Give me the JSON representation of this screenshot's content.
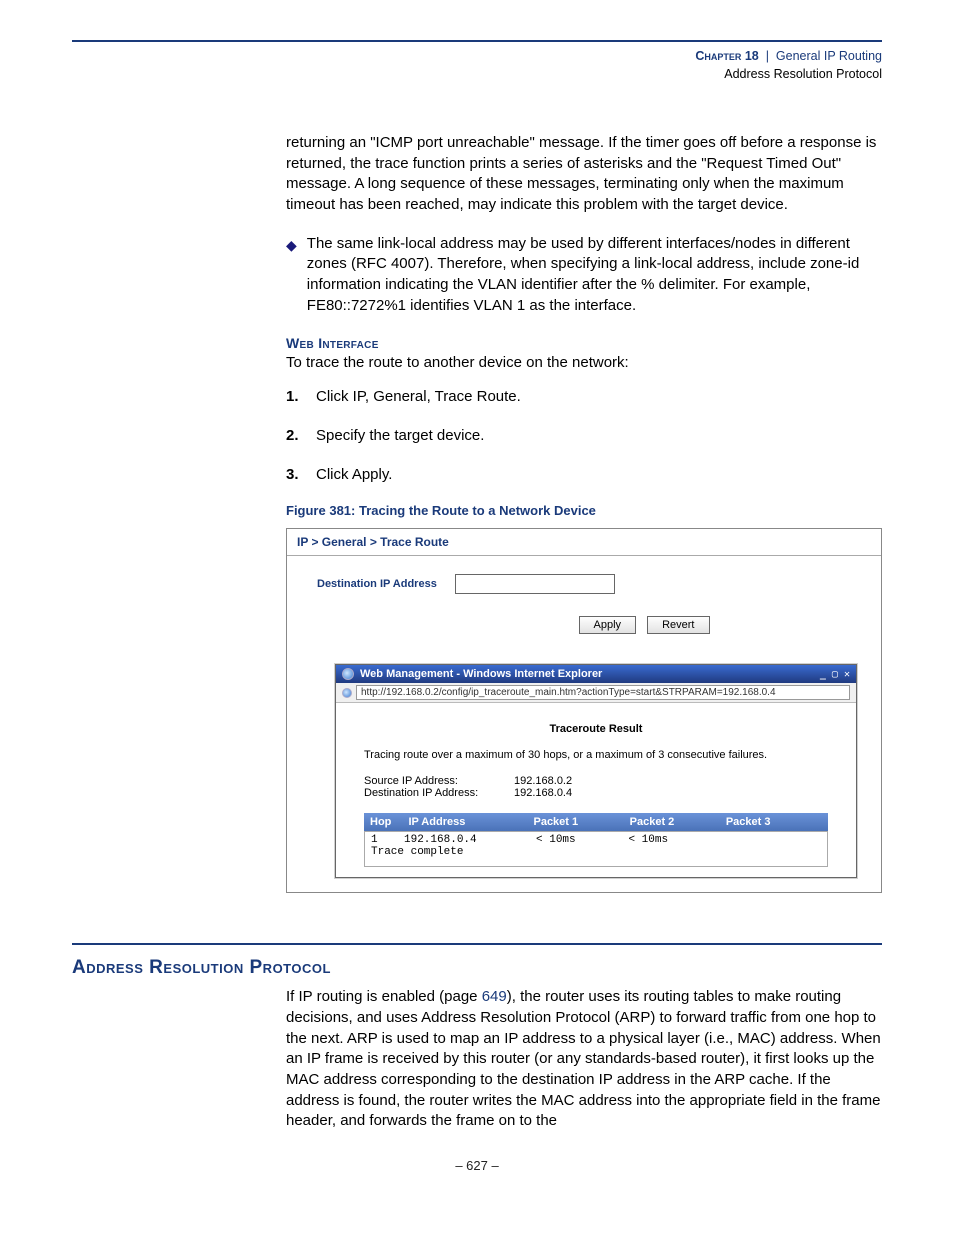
{
  "header": {
    "chapter_label": "Chapter 18",
    "separator": "|",
    "title": "General IP Routing",
    "subtitle": "Address Resolution Protocol"
  },
  "para1": "returning an \"ICMP port unreachable\" message. If the timer goes off before a response is returned, the trace function prints a series of asterisks and the \"Request Timed Out\" message. A long sequence of these messages, terminating only when the maximum timeout has been reached, may indicate this problem with the target device.",
  "bullet1": "The same link-local address may be used by different interfaces/nodes in different zones (RFC 4007). Therefore, when specifying a link-local address, include zone-id information indicating the VLAN identifier after the % delimiter. For example, FE80::7272%1 identifies VLAN 1 as the interface.",
  "web_interface": {
    "heading": "Web Interface",
    "intro": "To trace the route to another device on the network:",
    "steps": [
      "Click IP, General, Trace Route.",
      "Specify the target device.",
      "Click Apply."
    ]
  },
  "figure": {
    "caption": "Figure 381:  Tracing the Route to a Network Device",
    "breadcrumb": "IP > General > Trace Route",
    "dest_label": "Destination IP Address",
    "apply_btn": "Apply",
    "revert_btn": "Revert",
    "popup_title": "Web Management - Windows Internet Explorer",
    "popup_url": "http://192.168.0.2/config/ip_traceroute_main.htm?actionType=start&STRPARAM=192.168.0.4",
    "result_title": "Traceroute Result",
    "result_line": "Tracing route over a maximum of 30 hops, or a maximum of 3 consecutive failures.",
    "src_label": "Source IP Address:",
    "src_val": "192.168.0.2",
    "dst_label": "Destination IP Address:",
    "dst_val": "192.168.0.4",
    "th_hop": "Hop",
    "th_ip": "IP Address",
    "th_p1": "Packet 1",
    "th_p2": "Packet 2",
    "th_p3": "Packet 3",
    "trace_output": "1    192.168.0.4         < 10ms        < 10ms\nTrace complete"
  },
  "arp": {
    "title": "Address Resolution Protocol",
    "text_before_link": "If IP routing is enabled (page ",
    "link": "649",
    "text_after_link": "), the router uses its routing tables to make routing decisions, and uses Address Resolution Protocol (ARP) to forward traffic from one hop to the next. ARP is used to map an IP address to a physical layer (i.e., MAC) address. When an IP frame is received by this router (or any standards-based router), it first looks up the MAC address corresponding to the destination IP address in the ARP cache. If the address is found, the router writes the MAC address into the appropriate field in the frame header, and forwards the frame on to the"
  },
  "page_number": "–  627  –"
}
